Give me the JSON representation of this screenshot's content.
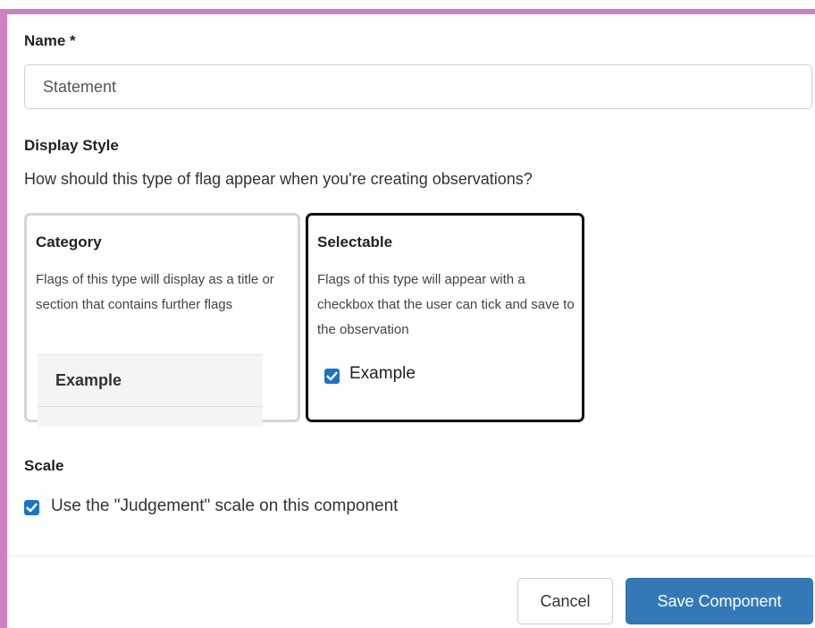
{
  "form": {
    "name_label": "Name *",
    "name_value": "Statement",
    "display_style_label": "Display Style",
    "display_style_question": "How should this type of flag appear when you're creating observations?"
  },
  "display_options": {
    "category": {
      "title": "Category",
      "description": "Flags of this type will display as a title or section that contains further flags",
      "example_label": "Example",
      "selected": false
    },
    "selectable": {
      "title": "Selectable",
      "description": "Flags of this type will appear with a checkbox that the user can tick and save to the observation",
      "example_label": "Example",
      "example_checked": true,
      "selected": true
    }
  },
  "scale": {
    "label": "Scale",
    "checkbox_label": "Use the \"Judgement\" scale on this component",
    "checked": true
  },
  "footer": {
    "cancel_label": "Cancel",
    "save_label": "Save Component"
  },
  "colors": {
    "frame_accent": "#cf7fc4",
    "primary_button": "#3379b8",
    "checkbox": "#1a73c9",
    "selected_card_border": "#111111",
    "unselected_card_border": "#d6d6d6"
  },
  "icons": {
    "checkbox_checked": "checkmark-icon"
  }
}
